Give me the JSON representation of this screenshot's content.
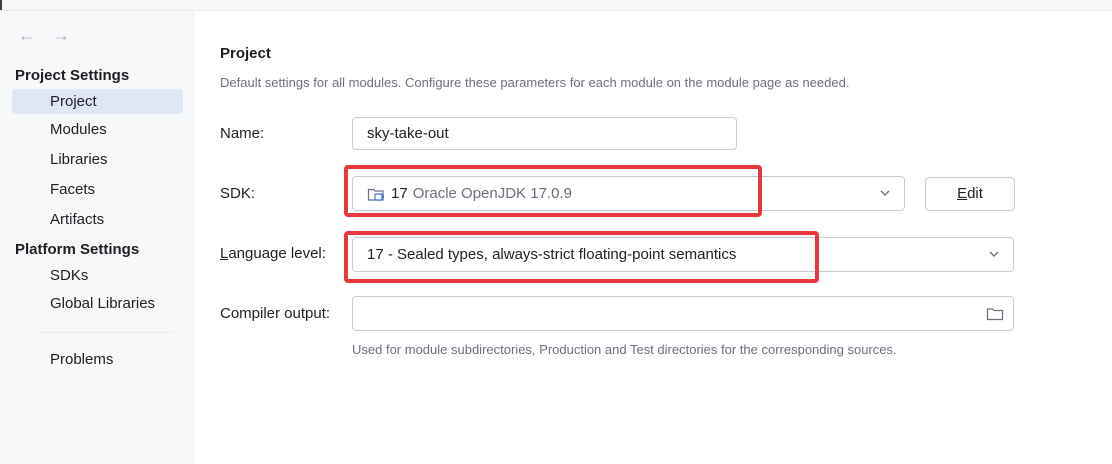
{
  "nav": {
    "back": "←",
    "forward": "→"
  },
  "sidebar": {
    "project_settings_title": "Project Settings",
    "project_settings_items": [
      "Project",
      "Modules",
      "Libraries",
      "Facets",
      "Artifacts"
    ],
    "platform_settings_title": "Platform Settings",
    "platform_settings_items": [
      "SDKs",
      "Global Libraries"
    ],
    "problems": "Problems",
    "selected": "Project"
  },
  "main": {
    "title": "Project",
    "description": "Default settings for all modules. Configure these parameters for each module on the module page as needed.",
    "name": {
      "label": "Name:",
      "value": "sky-take-out"
    },
    "sdk": {
      "label": "SDK:",
      "version": "17",
      "name": "Oracle OpenJDK 17.0.9",
      "edit_label_mnemonic": "E",
      "edit_label_rest": "dit"
    },
    "language_level": {
      "label_mnemonic": "L",
      "label_rest": "anguage level:",
      "value": "17 - Sealed types, always-strict floating-point semantics"
    },
    "compiler_output": {
      "label": "Compiler output:",
      "value": "",
      "hint": "Used for module subdirectories, Production and Test directories for the corresponding sources."
    }
  },
  "colors": {
    "highlight": "#e8383e",
    "selected_bg": "#dfe6f5",
    "sidebar_bg": "#f7f8fa"
  },
  "icons": [
    "back-arrow-icon",
    "forward-arrow-icon",
    "sdk-folder-icon",
    "chevron-down-icon",
    "folder-icon"
  ]
}
